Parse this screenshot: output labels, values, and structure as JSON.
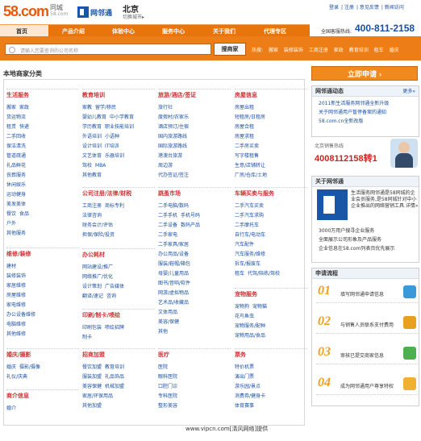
{
  "header": {
    "logo": "58.com",
    "logo_sub": "同城",
    "logo_sub2": "58.com",
    "brand2": "网邻通",
    "city": "北京",
    "switch_city": "切换城市▸",
    "top_links": [
      "登录",
      "注册",
      "意见反馈",
      "新闻访问"
    ],
    "hotline_label": "全国客服热线:",
    "hotline": "400-811-2158"
  },
  "nav": {
    "items": [
      "首页",
      "产品介绍",
      "体验中心",
      "服务中心",
      "关于我们",
      "代理专区"
    ]
  },
  "search": {
    "placeholder": "请输入您要查询的公司名称",
    "button": "搜商家",
    "hot_label": "热搜:",
    "hot_terms": [
      "搬家",
      "装修装饰",
      "工商注册",
      "家政",
      "教育培训",
      "租车",
      "婚庆"
    ]
  },
  "section_title": "本地商家分类",
  "categories": [
    {
      "title": "生活服务",
      "rows": [
        [
          "搬家",
          "家政"
        ],
        [
          "货运物流"
        ],
        [
          "租赁",
          "快递"
        ],
        [
          "二手回收"
        ],
        [
          "保洁清洗"
        ],
        [
          "管道疏通"
        ],
        [
          "礼品鲜花"
        ],
        [
          "丧葬服务"
        ],
        [
          "休闲娱乐"
        ],
        [
          "运动健身"
        ],
        [
          "美发美体"
        ],
        [
          "餐饮",
          "食品"
        ],
        [
          "户外"
        ],
        [
          "其他服务"
        ]
      ]
    },
    {
      "title": "教育培训",
      "rows": [
        [
          "家教",
          "留学/移民"
        ],
        [
          "婴幼儿教育",
          "中小学教育"
        ],
        [
          "学历教育",
          "职业技能培训"
        ],
        [
          "外语培训",
          "小语种"
        ],
        [
          "设计培训",
          "IT培训"
        ],
        [
          "文艺体育",
          "乐器培训"
        ],
        [
          "驾校",
          "MBA"
        ],
        [
          "其他教育"
        ]
      ]
    },
    {
      "title": "旅游/酒店/签证",
      "rows": [
        [
          "旅行社"
        ],
        [
          "度假村/农家乐"
        ],
        [
          "酒店预订/住宿"
        ],
        [
          "国内旅游路线"
        ],
        [
          "国际旅游路线"
        ],
        [
          "港澳台旅游"
        ],
        [
          "周边游"
        ],
        [
          "代办签证/签注"
        ]
      ]
    },
    {
      "title": "房屋信息",
      "rows": [
        [
          "房屋出租"
        ],
        [
          "短租房/日租房"
        ],
        [
          "房屋合租"
        ],
        [
          "房屋求租"
        ],
        [
          "二手房买卖"
        ],
        [
          "写字楼租售"
        ],
        [
          "生意/店铺转让"
        ],
        [
          "厂房/仓库/土地"
        ]
      ]
    },
    {
      "title": "维修/装修",
      "rows": [
        [
          "建材"
        ],
        [
          "装修装饰"
        ],
        [
          "家居维修"
        ],
        [
          "房屋维修"
        ],
        [
          "家电维修"
        ],
        [
          "办公设备维修"
        ],
        [
          "电脑维修"
        ],
        [
          "其他维修"
        ]
      ]
    },
    {
      "title": "公司注册/法律/财税",
      "rows": [
        [
          "工商注册",
          "商标专利"
        ],
        [
          "法律咨询"
        ],
        [
          "财务会计/评估"
        ],
        [
          "担保/保险/投资"
        ]
      ]
    },
    {
      "title": "跳蚤市场",
      "rows": [
        [
          "二手电脑/数码"
        ],
        [
          "二手手机",
          "手机号码"
        ],
        [
          "二手设备",
          "数码产品"
        ],
        [
          "二手家电"
        ],
        [
          "二手家具/家居"
        ],
        [
          "办公用品/设备"
        ],
        [
          "服装/鞋帽/箱包"
        ],
        [
          "母婴/儿童用品"
        ],
        [
          "图书/音响/软件"
        ],
        [
          "网游/虚拟物品"
        ],
        [
          "艺术品/收藏品"
        ],
        [
          "文体用品"
        ],
        [
          "美容/保健"
        ],
        [
          "其他"
        ]
      ]
    },
    {
      "title": "车辆买卖与服务",
      "rows": [
        [
          "二手汽车买卖"
        ],
        [
          "二手汽车求购"
        ],
        [
          "二手摩托车"
        ],
        [
          "自行车/电动车"
        ],
        [
          "汽车配件"
        ],
        [
          "汽车服务/维修"
        ],
        [
          "拆车/报废车"
        ],
        [
          "租车",
          "代驾/陪练/驾校"
        ]
      ]
    },
    {
      "title": "办公耗材",
      "rows": [
        [
          "网站建设/推广"
        ],
        [
          "网络推广/优化"
        ],
        [
          "设计策划",
          "广告媒体"
        ],
        [
          "翻译/速记",
          "咨询"
        ]
      ]
    },
    {
      "title": "宠物服务",
      "rows": [
        [
          "宠物狗",
          "宠物猫"
        ],
        [
          "花鸟鱼虫"
        ],
        [
          "宠物服务/配种"
        ],
        [
          "宠物用品/食品"
        ]
      ]
    },
    {
      "title": "印刷/制卡/喷绘",
      "rows": [
        [
          "印刷包装",
          "喷绘招牌"
        ],
        [
          "制卡"
        ]
      ]
    },
    {
      "title": "婚庆/摄影",
      "rows": [
        [
          "婚庆",
          "摄影/摄像"
        ],
        [
          "礼仪/庆典"
        ]
      ]
    },
    {
      "title": "招商加盟",
      "rows": [
        [
          "餐饮加盟",
          "教育培训"
        ],
        [
          "服装加盟",
          "礼品饰品"
        ],
        [
          "美容保健",
          "机械加盟"
        ],
        [
          "家居/环保用品"
        ],
        [
          "其他加盟"
        ]
      ]
    },
    {
      "title": "医疗",
      "rows": [
        [
          "医院"
        ],
        [
          "眼科医院"
        ],
        [
          "口腔门诊"
        ],
        [
          "专科医院"
        ],
        [
          "整形美容"
        ]
      ]
    },
    {
      "title": "票务",
      "rows": [
        [
          "特价机票"
        ],
        [
          "演出门票"
        ],
        [
          "游乐园/景点"
        ],
        [
          "消费券/健身卡"
        ],
        [
          "体育赛事"
        ]
      ]
    },
    {
      "title": "商介信息",
      "rows": [
        [
          "婚介"
        ]
      ]
    }
  ],
  "sidebar": {
    "apply": "立即申请",
    "apply_arrow": "›",
    "news_title": "网邻通动态",
    "more": "更多»",
    "news": [
      "2011新生活服务网邻通全新升级",
      "关于网邻通用户暂停备案的通知",
      "58.com.cn全新改版"
    ],
    "hotline_label": "北京销售热线",
    "hotline": "4008112158转1",
    "about_title": "关于网邻通",
    "about_text": "生活服务网邻通是58同城的企业会员服务,是58同城针对中小企业推出的网络营销工具.详情»",
    "about_list": [
      "3000万用户搜寻企业服务",
      "全面展示公司形象及产品服务",
      "企业信息在58.com列表页优先展示"
    ],
    "process_title": "申请流程",
    "steps": [
      {
        "n": "01",
        "t": "填写网邻通申请信息"
      },
      {
        "n": "02",
        "t": "与销售人员联系支付费用"
      },
      {
        "n": "03",
        "t": "审核已提交商家信息"
      },
      {
        "n": "04",
        "t": "成为网邻通用户尊享特权"
      }
    ]
  },
  "footer": "www.vipcn.com[清风网络]提供",
  "colors": {
    "nav": "#e8740c",
    "accent": "#d02020",
    "link": "#1a4fa0"
  }
}
